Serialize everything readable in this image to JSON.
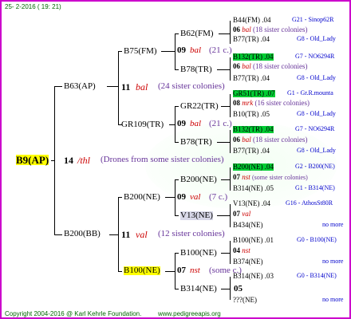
{
  "header": {
    "date": "25-  2-2016  ( 19: 21)"
  },
  "root": {
    "id": "B9(AP)",
    "count": "14",
    "mark": "/thl",
    "note": "(Drones from some sister colonies)"
  },
  "gen1": [
    {
      "id": "B63(AP)",
      "count": "11",
      "mark": "bal",
      "note": "(24 sister colonies)"
    },
    {
      "id": "B200(BB)",
      "count": "11",
      "mark": "val",
      "note": "(12 sister colonies)"
    }
  ],
  "gen2": [
    {
      "id": "B75(FM)"
    },
    {
      "id": "GR109(TR)",
      "count": "09",
      "mark": "bal",
      "note": "(21 c.)"
    },
    {
      "id": "B200(NE)",
      "count": "09",
      "mark": "val",
      "note": "(7 c.)"
    },
    {
      "id": "B100(NE)",
      "count": "07",
      "mark": "nst",
      "note": "(some c.)"
    }
  ],
  "gen3": [
    {
      "id": "B62(FM)",
      "count": "09",
      "mark": "bal",
      "note": "(21 c.)"
    },
    {
      "id": "B78(TR)"
    },
    {
      "id": "GR22(TR)",
      "count": "09",
      "mark": "bal",
      "note": "(21 c.)"
    },
    {
      "id": "B78(TR)"
    },
    {
      "id": "B200(NE)"
    },
    {
      "id": "V13(NE)"
    },
    {
      "id": "B100(NE)"
    },
    {
      "id": "B314(NE)",
      "count": "05"
    }
  ],
  "gen4": [
    {
      "id": "B44(FM)",
      "v": ".04",
      "info": "G21 - Sinop62R",
      "sub_count": "06",
      "sub_mark": "bal",
      "sub_note": "(18 sister colonies)"
    },
    {
      "id": "B77(TR)",
      "v": ".04",
      "info": "G8 - Old_Lady"
    },
    {
      "id": "B132(TR)",
      "v": ".04",
      "info": "G7 - NO6294R",
      "sub_count": "06",
      "sub_mark": "bal",
      "sub_note": "(18 sister colonies)"
    },
    {
      "id": "B77(TR)",
      "v": ".04",
      "info": "G8 - Old_Lady"
    },
    {
      "id": "GR51(TR)",
      "v": ".07",
      "info": "G1 - Gr.R.mounta",
      "sub_count": "08",
      "sub_mark": "mrk",
      "sub_note": "(16 sister colonies)"
    },
    {
      "id": "B10(TR)",
      "v": ".05",
      "info": "G8 - Old_Lady"
    },
    {
      "id": "B132(TR)",
      "v": ".04",
      "info": "G7 - NO6294R",
      "sub_count": "06",
      "sub_mark": "bal",
      "sub_note": "(18 sister colonies)"
    },
    {
      "id": "B77(TR)",
      "v": ".04",
      "info": "G8 - Old_Lady"
    },
    {
      "id": "B200(NE)",
      "v": ".04",
      "info": "G2 - B200(NE)",
      "sub_count": "07",
      "sub_mark": "nst",
      "sub_note": "(some sister colonies)"
    },
    {
      "id": "B314(NE)",
      "v": ".05",
      "info": "G1 - B314(NE)"
    },
    {
      "id": "V13(NE)",
      "v": ".04",
      "info": "G16 - AthosSt80R",
      "sub_count": "07",
      "sub_mark": "val",
      "sub_note": ""
    },
    {
      "id": "B434(NE)",
      "v": "",
      "info": "no more"
    },
    {
      "id": "B100(NE)",
      "v": ".01",
      "info": "G0 - B100(NE)",
      "sub_count": "04",
      "sub_mark": "nst",
      "sub_note": ""
    },
    {
      "id": "B374(NE)",
      "v": "",
      "info": "no more"
    },
    {
      "id": "B314(NE)",
      "v": ".03",
      "info": "G0 - B314(NE)"
    },
    {
      "id": "???(NE)",
      "v": "",
      "info": "no more"
    }
  ],
  "footer": {
    "copyright": "Copyright 2004-2016 @ Karl Kehrle Foundation.",
    "url": "www.pedigreeapis.org"
  },
  "colors": {
    "border": "#cc00cc",
    "highlight_yellow": "#ffff00",
    "highlight_green": "#00cc33",
    "mark_red": "#cc0000",
    "sister_note": "#663399",
    "info_blue": "#0000cc",
    "footer_green": "#006600"
  }
}
